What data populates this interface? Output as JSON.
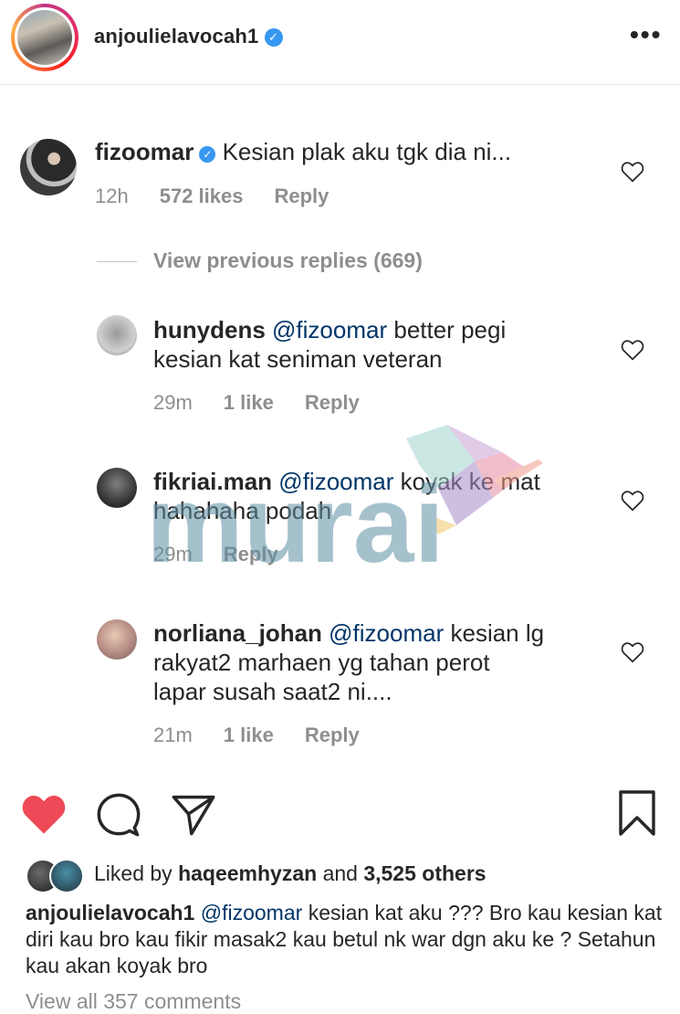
{
  "header": {
    "username": "anjoulielavocah1",
    "verified_mark": "✓",
    "more_glyph": "•••"
  },
  "comments": [
    {
      "username": "fizoomar",
      "verified_mark": "✓",
      "text": "Kesian plak aku tgk dia ni...",
      "time": "12h",
      "likes": "572 likes",
      "reply": "Reply"
    },
    {
      "username": "hunydens",
      "mention": "@fizoomar",
      "text_line1": "better pegi",
      "text_line2": "kesian kat seniman veteran",
      "time": "29m",
      "likes": "1 like",
      "reply": "Reply"
    },
    {
      "username": "fikriai.man",
      "mention": "@fizoomar",
      "text_line1": "koyak ke mat",
      "text_line2": "hahahaha podah",
      "time": "29m",
      "reply": "Reply"
    },
    {
      "username": "norliana_johan",
      "mention": "@fizoomar",
      "text_line1": "kesian lg",
      "text_line2": "rakyat2 marhaen yg tahan perot",
      "text_line3": "lapar susah saat2 ni....",
      "time": "21m",
      "likes": "1 like",
      "reply": "Reply"
    }
  ],
  "view_previous_replies": "View previous replies (669)",
  "likes": {
    "prefix": "Liked by",
    "user": "haqeemhyzan",
    "and": "and",
    "others": "3,525 others"
  },
  "caption": {
    "username": "anjoulielavocah1",
    "mention": "@fizoomar",
    "text": "kesian kat aku ??? Bro kau kesian kat diri kau bro kau fikir masak2 kau betul nk war dgn aku ke ? Setahun kau akan koyak bro"
  },
  "view_all_comments": "View all 357 comments",
  "watermark": {
    "text": "murai"
  },
  "icons": {
    "like": "heart-filled-icon",
    "comment": "comment-bubble-icon",
    "share": "paper-plane-icon",
    "save": "bookmark-icon"
  },
  "colors": {
    "like_red": "#ed4956",
    "mention_blue": "#003569",
    "verified_blue": "#3897f0",
    "meta_gray": "#8e8e8e"
  }
}
